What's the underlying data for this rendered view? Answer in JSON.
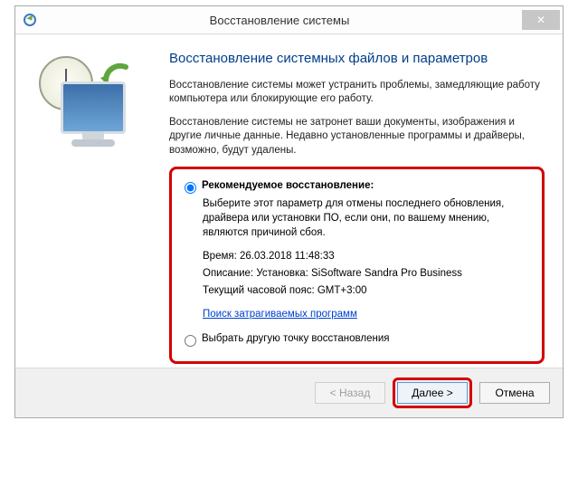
{
  "titlebar": {
    "title": "Восстановление системы",
    "close_glyph": "✕"
  },
  "main": {
    "heading": "Восстановление системных файлов и параметров",
    "para1": "Восстановление системы может устранить проблемы, замедляющие работу компьютера или блокирующие его работу.",
    "para2": "Восстановление системы не затронет ваши документы, изображения и другие личные данные. Недавно установленные программы и драйверы, возможно, будут удалены."
  },
  "options": {
    "recommended": {
      "label": "Рекомендуемое восстановление:",
      "desc": "Выберите этот параметр для отмены последнего обновления, драйвера или установки ПО, если они, по вашему мнению, являются причиной сбоя.",
      "time_label": "Время:",
      "time_value": "26.03.2018 11:48:33",
      "desc_label": "Описание:",
      "desc_value": "Установка: SiSoftware Sandra Pro Business",
      "tz_label": "Текущий часовой пояс:",
      "tz_value": "GMT+3:00",
      "link": "Поиск затрагиваемых программ"
    },
    "other": {
      "label": "Выбрать другую точку восстановления"
    }
  },
  "footer": {
    "back": "< Назад",
    "next": "Далее >",
    "cancel": "Отмена"
  }
}
